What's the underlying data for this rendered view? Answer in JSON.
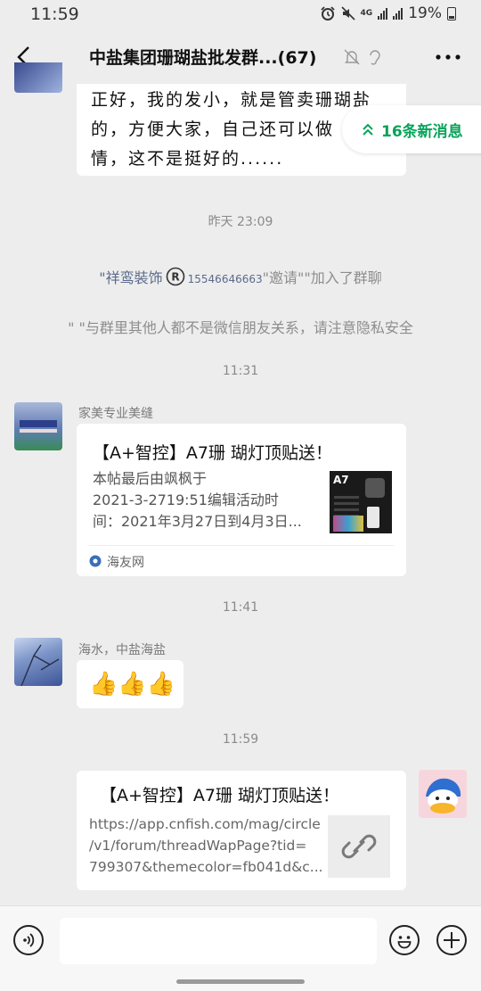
{
  "status": {
    "time": "11:59",
    "network": "4G",
    "battery": "19%"
  },
  "header": {
    "title": "中盐集团珊瑚盐批发群...(67)"
  },
  "new_messages": {
    "label": "16条新消息"
  },
  "first_message": {
    "lines": [
      "正好，我的发小，就是管卖珊瑚盐",
      "的，方便大家，自己还可以做",
      "情，这不是挺好的......"
    ]
  },
  "timestamps": [
    "昨天 23:09",
    "11:31",
    "11:41",
    "11:59"
  ],
  "system": {
    "invite_name": "\"祥鸾裝饰",
    "invite_phone": "15546646663",
    "invite_text": "\"邀请\"\"加入了群聊",
    "privacy": "\" \"与群里其他人都不是微信朋友关系，请注意隐私安全"
  },
  "msg_card": {
    "sender": "家美专业美缝",
    "title": "【A+智控】A7珊 瑚灯顶贴送！",
    "desc_lines": [
      "本帖最后由飒枫于",
      "2021-3-2719:51编辑活动时",
      "间：2021年3月27日到4月3日..."
    ],
    "thumb_label": "A7",
    "source": "海友网"
  },
  "msg_thumbs": {
    "sender": "海水，中盐海盐",
    "content": "👍👍👍"
  },
  "msg_link": {
    "title": "【A+智控】A7珊 瑚灯顶贴送！",
    "url_lines": [
      "https://app.cnfish.com/mag/circle",
      "/v1/forum/threadWapPage?tid=",
      "799307&themecolor=fb041d&c..."
    ]
  },
  "colors": {
    "accent_green": "#07a35a",
    "bg": "#ededed"
  }
}
